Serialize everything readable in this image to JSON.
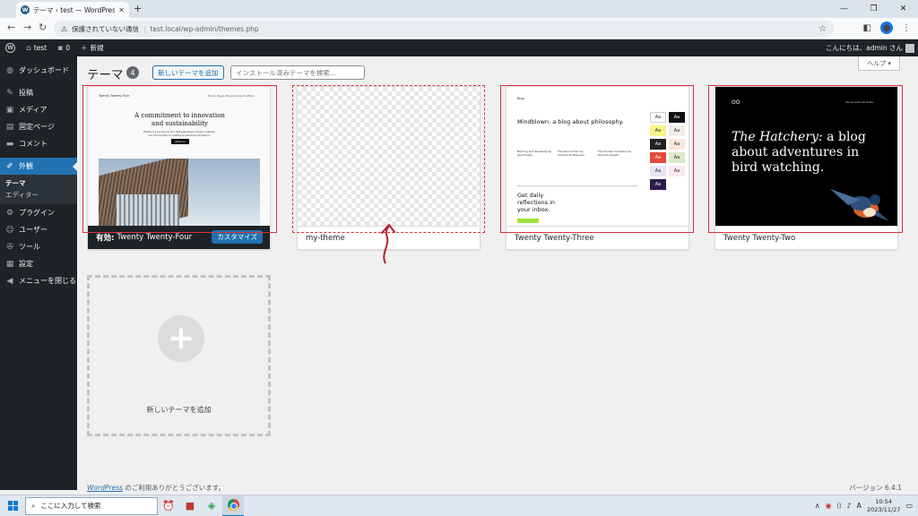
{
  "browser": {
    "tab_title": "テーマ ‹ test — WordPress",
    "tab_close": "✕",
    "new_tab": "+",
    "insecure_label": "保護されていない通信",
    "url": "test.local/wp-admin/themes.php",
    "warn_icon": "⚠",
    "star_icon": "☆"
  },
  "adminbar": {
    "site_name": "test",
    "comments_count": "0",
    "new_label": "新規",
    "howdy": "こんにちは、admin さん"
  },
  "sidebar": {
    "items": [
      {
        "label": "ダッシュボード",
        "icon": "◍"
      },
      {
        "label": "投稿",
        "icon": "✎"
      },
      {
        "label": "メディア",
        "icon": "▣"
      },
      {
        "label": "固定ページ",
        "icon": "▤"
      },
      {
        "label": "コメント",
        "icon": "▬"
      },
      {
        "label": "外観",
        "icon": "✐"
      },
      {
        "label": "プラグイン",
        "icon": "⚙"
      },
      {
        "label": "ユーザー",
        "icon": "☺"
      },
      {
        "label": "ツール",
        "icon": "✇"
      },
      {
        "label": "設定",
        "icon": "▦"
      },
      {
        "label": "メニューを閉じる",
        "icon": "◀"
      }
    ],
    "sub_items": [
      "テーマ",
      "エディター"
    ]
  },
  "main": {
    "help_label": "ヘルプ ▾",
    "page_title": "テーマ",
    "theme_count": "4",
    "add_new_button": "新しいテーマを追加",
    "search_placeholder": "インストール済みテーマを検索...",
    "themes": [
      {
        "name": "Twenty Twenty-Four",
        "active_prefix": "有効:",
        "customize": "カスタマイズ",
        "preview": {
          "site": "Twenty Twenty-Four",
          "nav": "Home   Pages   Blog   Articles   Portfolio",
          "headline": "A commitment to innovation and sustainability",
          "sub": "Études is a pioneering firm that seamlessly merges creativity and functionality to redefine architectural excellence.",
          "button": "About us"
        }
      },
      {
        "name": "my-theme"
      },
      {
        "name": "Twenty Twenty-Three",
        "preview": {
          "site": "Blog",
          "headline": "Mindblown: a blog about philosophy.",
          "posts": [
            "Naming and Necessity by Saul Kripke",
            "The Second Sex by Simone de Beauvoir",
            "The Human Condition by Hannah Arendt"
          ],
          "cta": "Get daily reflections in your inbox.",
          "aa": "Aa"
        }
      },
      {
        "name": "Twenty Twenty-Two",
        "preview": {
          "nav": "About   Links   All Posts",
          "italic": "The Hatchery:",
          "rest": " a blog about adventures in bird watching."
        }
      }
    ],
    "add_theme_card_label": "新しいテーマを追加",
    "plus": "+"
  },
  "footer": {
    "wp_link": "WordPress",
    "thanks": " のご利用ありがとうございます。",
    "version": "バージョン 6.4.1"
  },
  "taskbar": {
    "search_text": "ここに入力して検索",
    "time": "10:54",
    "date": "2023/11/27",
    "ime": "A"
  },
  "colors": {
    "admin_dark": "#1d2327",
    "accent_blue": "#2271b1",
    "highlight_red": "#d6323a"
  }
}
